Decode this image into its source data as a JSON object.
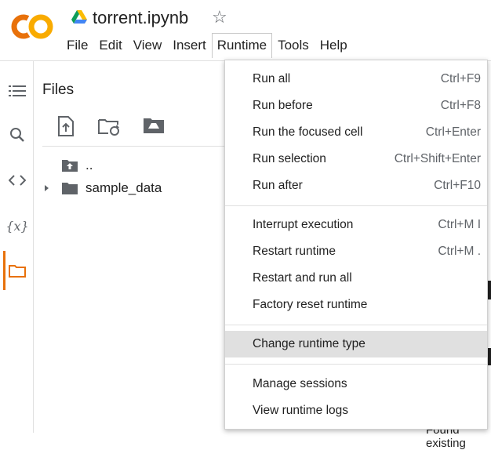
{
  "header": {
    "title": "torrent.ipynb",
    "menu": [
      "File",
      "Edit",
      "View",
      "Insert",
      "Runtime",
      "Tools",
      "Help"
    ],
    "active_menu": "Runtime"
  },
  "sidebar": {
    "rail_icons": [
      "table-of-contents-icon",
      "search-icon",
      "code-snippets-icon",
      "variables-icon",
      "folder-icon"
    ],
    "variables_glyph": "{x}",
    "active": "folder-icon"
  },
  "files": {
    "title": "Files",
    "toolbar": [
      "upload-file-icon",
      "refresh-folder-icon",
      "mount-drive-icon"
    ],
    "tree": [
      {
        "label": ".."
      },
      {
        "label": "sample_data"
      }
    ]
  },
  "runtime_menu": {
    "groups": [
      [
        {
          "label": "Run all",
          "shortcut": "Ctrl+F9"
        },
        {
          "label": "Run before",
          "shortcut": "Ctrl+F8"
        },
        {
          "label": "Run the focused cell",
          "shortcut": "Ctrl+Enter"
        },
        {
          "label": "Run selection",
          "shortcut": "Ctrl+Shift+Enter"
        },
        {
          "label": "Run after",
          "shortcut": "Ctrl+F10"
        }
      ],
      [
        {
          "label": "Interrupt execution",
          "shortcut": "Ctrl+M I"
        },
        {
          "label": "Restart runtime",
          "shortcut": "Ctrl+M ."
        },
        {
          "label": "Restart and run all",
          "shortcut": ""
        },
        {
          "label": "Factory reset runtime",
          "shortcut": ""
        }
      ],
      [
        {
          "label": "Change runtime type",
          "shortcut": "",
          "highlighted": true
        }
      ],
      [
        {
          "label": "Manage sessions",
          "shortcut": ""
        },
        {
          "label": "View runtime logs",
          "shortcut": ""
        }
      ]
    ]
  },
  "background": {
    "partial_text": "Found existing"
  },
  "colors": {
    "accent": "#e8710a",
    "logo_orange": "#f9ab00",
    "highlight": "#e0e0e0"
  }
}
